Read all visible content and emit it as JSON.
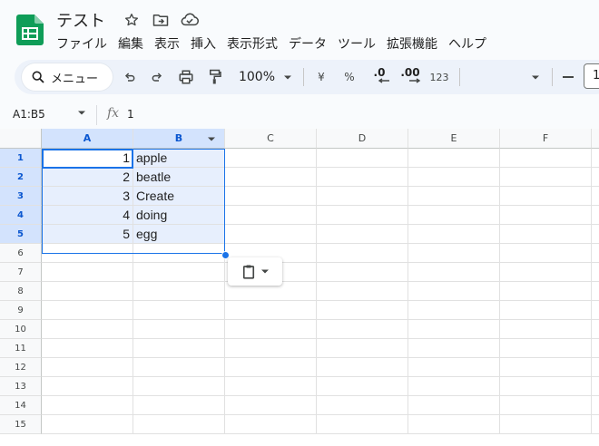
{
  "header": {
    "title": "テスト",
    "menu": [
      "ファイル",
      "編集",
      "表示",
      "挿入",
      "表示形式",
      "データ",
      "ツール",
      "拡張機能",
      "ヘルプ"
    ],
    "icons": [
      "star-icon",
      "folder-move-icon",
      "cloud-icon"
    ]
  },
  "toolbar": {
    "search_label": "メニュー",
    "zoom": "100%",
    "currency": "¥",
    "percent": "%",
    "decrease_decimal": ".0",
    "increase_decimal": ".00",
    "number_format": "123",
    "font_size_partial": "1"
  },
  "formula_bar": {
    "name_box": "A1:B5",
    "fx": "fx",
    "value": "1"
  },
  "sheet": {
    "columns": [
      "A",
      "B",
      "C",
      "D",
      "E",
      "F"
    ],
    "rows": [
      "1",
      "2",
      "3",
      "4",
      "5",
      "6",
      "7",
      "8",
      "9",
      "10",
      "11",
      "12",
      "13",
      "14",
      "15"
    ],
    "data": [
      {
        "a": "1",
        "b": "apple"
      },
      {
        "a": "2",
        "b": "beatle"
      },
      {
        "a": "3",
        "b": "Create"
      },
      {
        "a": "4",
        "b": "doing"
      },
      {
        "a": "5",
        "b": "egg"
      }
    ]
  },
  "colors": {
    "accent": "#1a73e8",
    "selection_fill": "#e7effd",
    "header_selected": "#d3e3fd",
    "logo_green": "#0f9d58"
  }
}
